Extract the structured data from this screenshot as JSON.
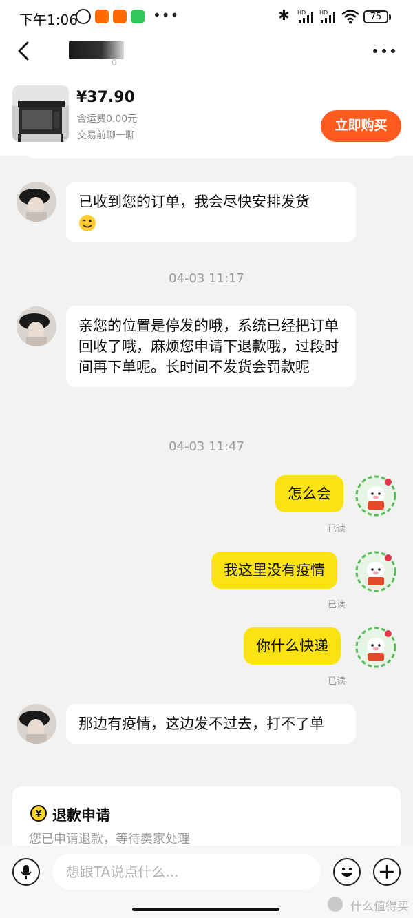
{
  "status_bar": {
    "time": "下午1:06",
    "dots": "•••",
    "hd_label": "HD",
    "battery": "75"
  },
  "nav": {
    "contact_sub": "0"
  },
  "product": {
    "price": "¥37.90",
    "shipping": "含运费0.00元",
    "hint": "交易前聊一聊",
    "buy_label": "立即购买"
  },
  "messages": [
    {
      "side": "in",
      "text": "已收到您的订单，我会尽快安排发货",
      "emoji": "wink-emoji"
    },
    {
      "type": "timestamp",
      "text": "04-03 11:17"
    },
    {
      "side": "in",
      "text": "亲您的位置是停发的哦，系统已经把订单回收了哦，麻烦您申请下退款哦，过段时间再下单呢。长时间不发货会罚款呢"
    },
    {
      "type": "timestamp",
      "text": "04-03 11:47"
    },
    {
      "side": "out",
      "text": "怎么会",
      "status": "已读"
    },
    {
      "side": "out",
      "text": "我这里没有疫情",
      "status": "已读"
    },
    {
      "side": "out",
      "text": "你什么快递",
      "status": "已读"
    },
    {
      "side": "in",
      "text": "那边有疫情，这边发不过去，打不了单"
    }
  ],
  "refund": {
    "title": "退款申请",
    "desc": "您已申请退款，等待卖家处理"
  },
  "input": {
    "placeholder": "想跟TA说点什么..."
  },
  "watermark": "什么值得买",
  "colors": {
    "accent_orange": "#ff5a1f",
    "bubble_yellow": "#fbe313",
    "background": "#f2f2f2"
  }
}
